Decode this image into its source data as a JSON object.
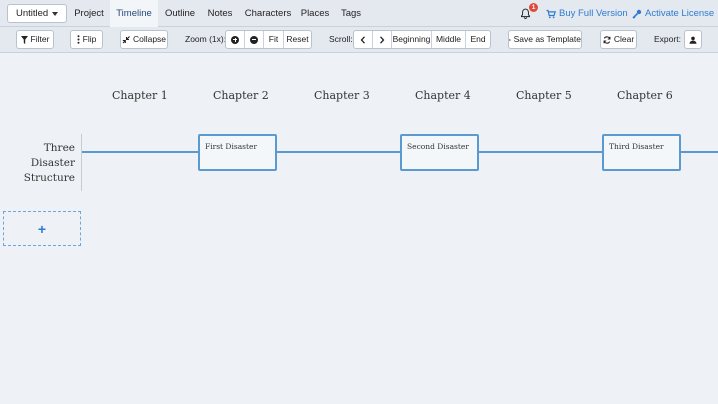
{
  "topbar": {
    "project": "Untitled",
    "tabs": [
      "Project",
      "Timeline",
      "Outline",
      "Notes",
      "Characters",
      "Places",
      "Tags"
    ],
    "active_tab": "Timeline",
    "notification_count": "1",
    "buy_label": "Buy Full Version",
    "activate_label": "Activate License"
  },
  "toolbar": {
    "filter": "Filter",
    "flip": "Flip",
    "collapse": "Collapse",
    "zoom_label": "Zoom (1x):",
    "fit": "Fit",
    "reset": "Reset",
    "scroll_label": "Scroll:",
    "beginning": "Beginning",
    "middle": "Middle",
    "end": "End",
    "save_template": "Save as Template",
    "clear": "Clear",
    "export_label": "Export:"
  },
  "timeline": {
    "chapters": [
      "Chapter 1",
      "Chapter 2",
      "Chapter 3",
      "Chapter 4",
      "Chapter 5",
      "Chapter 6"
    ],
    "row_label": "Three Disaster Structure",
    "cards": [
      {
        "title": "First Disaster"
      },
      {
        "title": "Second Disaster"
      },
      {
        "title": "Third Disaster"
      }
    ],
    "add_row": "+"
  },
  "colors": {
    "accent": "#2f7bd0",
    "timeline_line": "#5b9ad0",
    "badge": "#e04a3b",
    "background": "#eef2f6"
  }
}
